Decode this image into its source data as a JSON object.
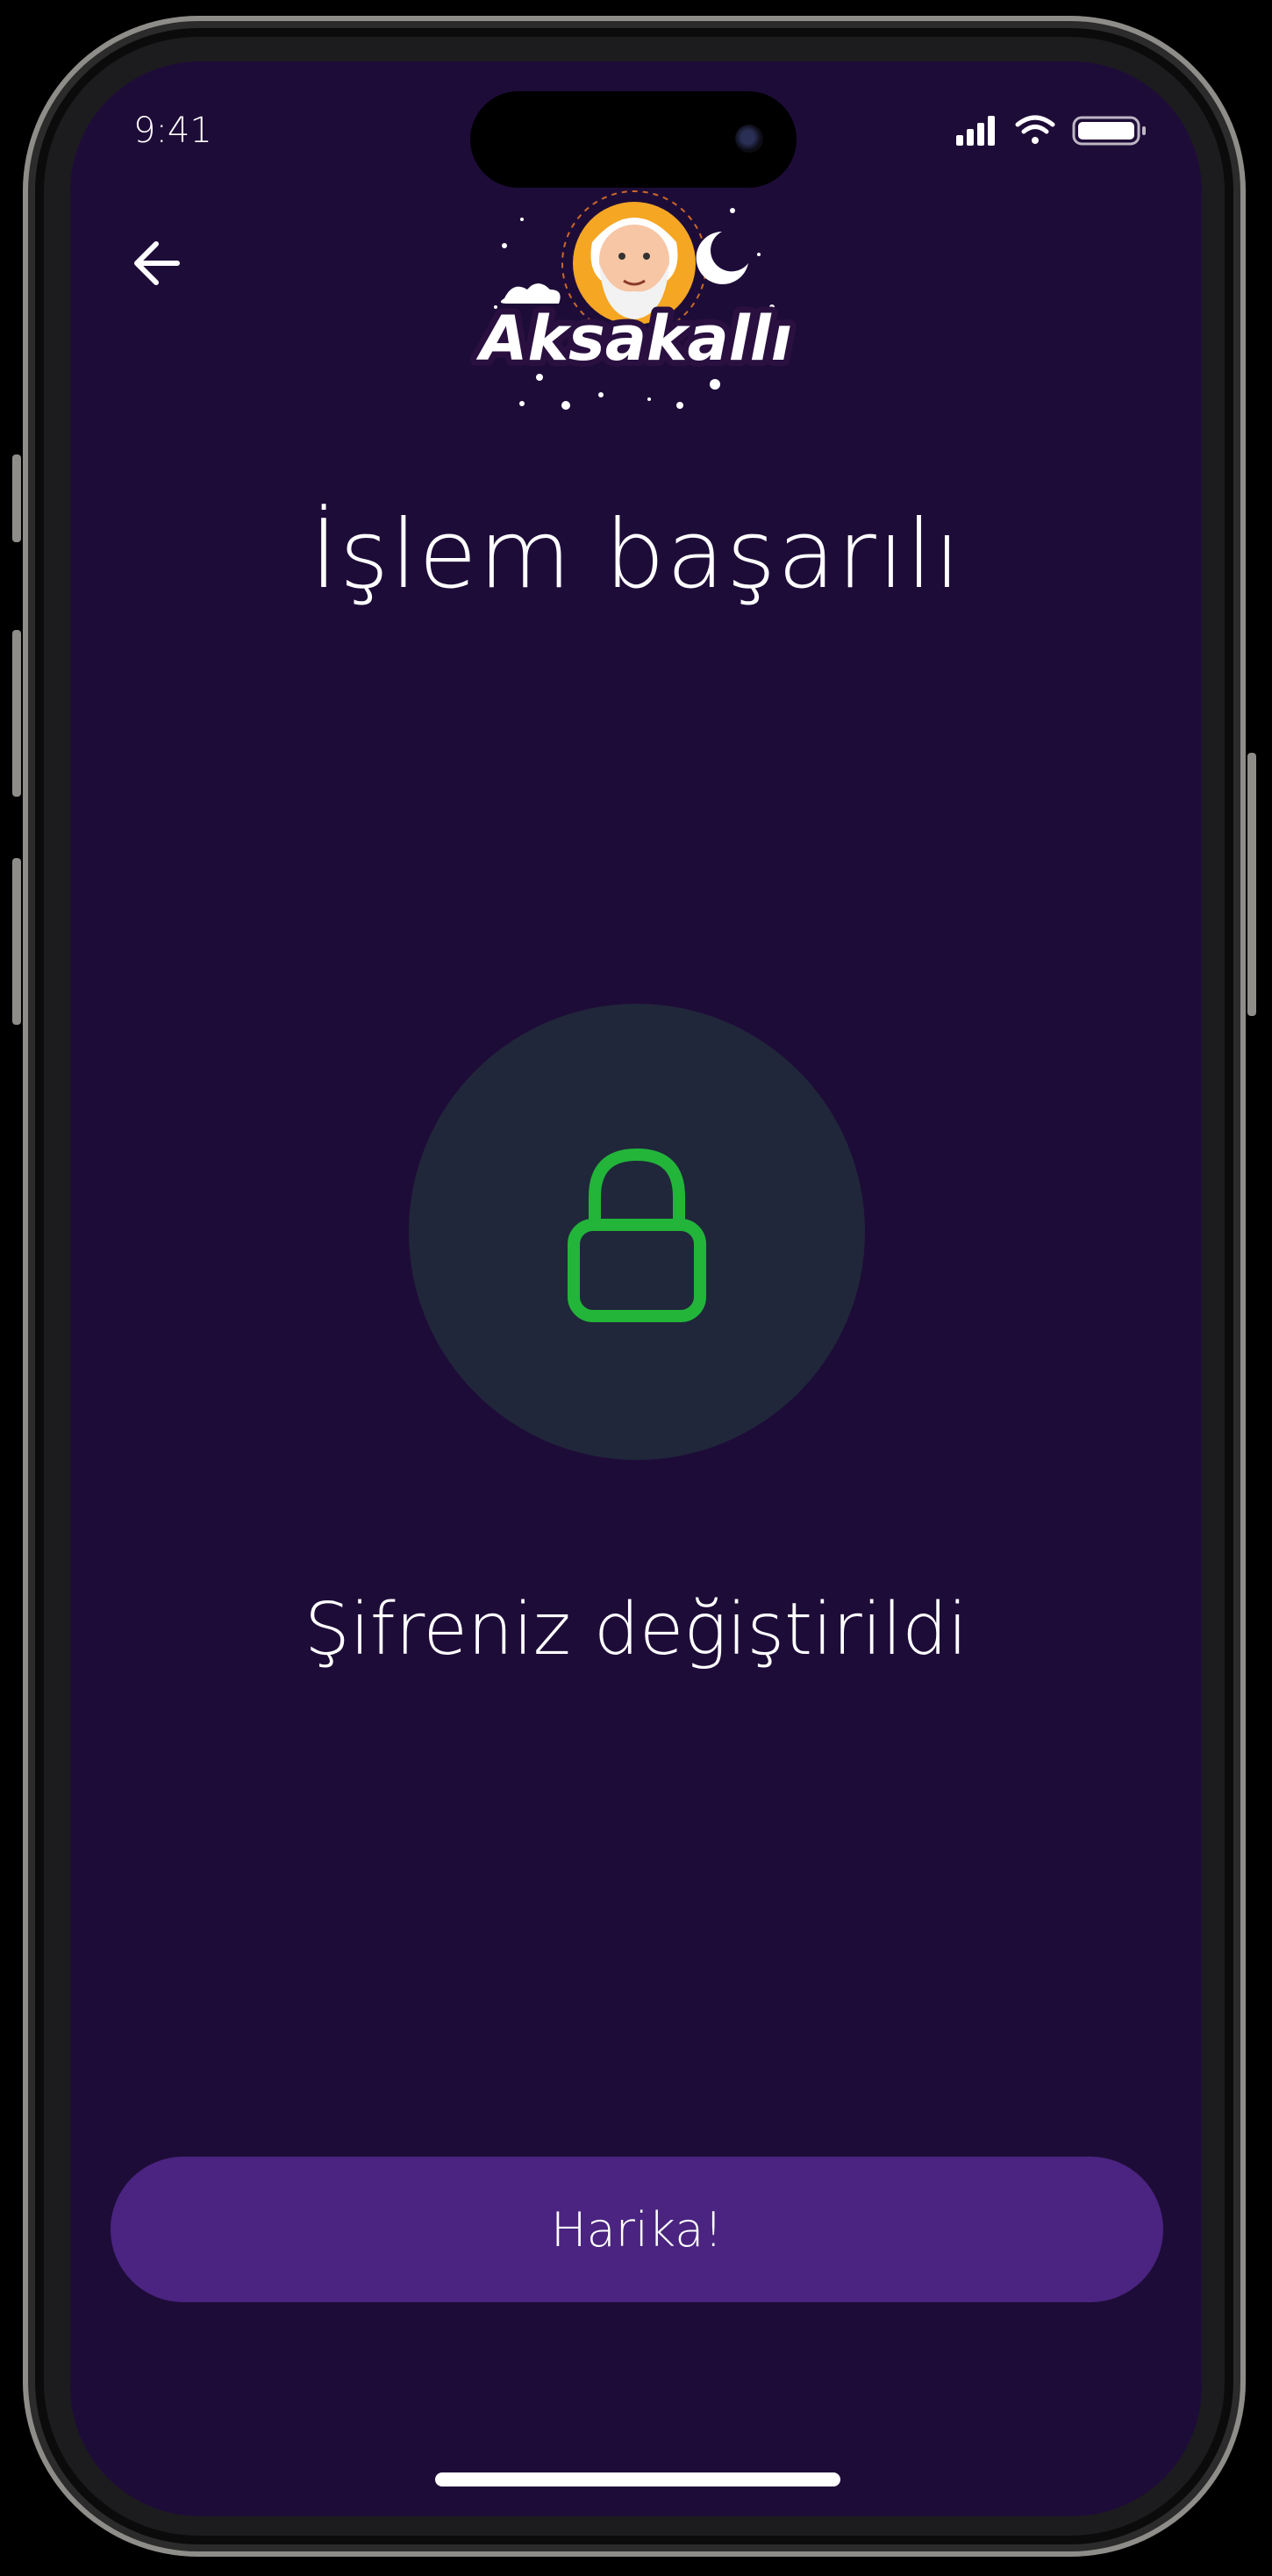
{
  "status_bar": {
    "time": "9:41"
  },
  "header": {
    "back_icon": "arrow-left-icon",
    "logo_text": "Aksakallı"
  },
  "main": {
    "title": "İşlem başarılı",
    "lock_icon": "lock-icon",
    "lock_color": "#22b53a",
    "message": "Şifreniz değiştirildi"
  },
  "footer": {
    "button_label": "Harika!"
  },
  "colors": {
    "background": "#1e0c38",
    "button": "#4a2480",
    "circle": "#20273a"
  }
}
